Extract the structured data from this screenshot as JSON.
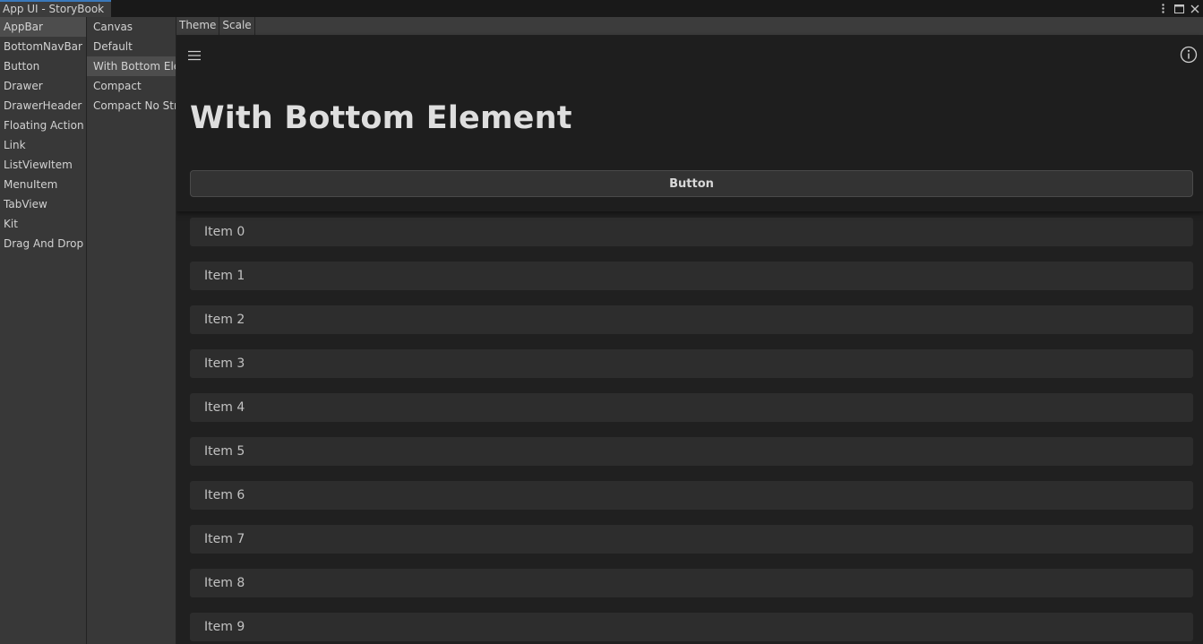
{
  "window": {
    "tab_title": "App UI - StoryBook"
  },
  "stories": [
    {
      "label": "AppBar",
      "selected": true
    },
    {
      "label": "BottomNavBar"
    },
    {
      "label": "Button"
    },
    {
      "label": "Drawer"
    },
    {
      "label": "DrawerHeader"
    },
    {
      "label": "Floating Action Button"
    },
    {
      "label": "Link"
    },
    {
      "label": "ListViewItem"
    },
    {
      "label": "MenuItem"
    },
    {
      "label": "TabView"
    },
    {
      "label": "Kit"
    },
    {
      "label": "Drag And Drop"
    }
  ],
  "variants": [
    {
      "label": "Canvas"
    },
    {
      "label": "Default"
    },
    {
      "label": "With Bottom Element",
      "selected": true
    },
    {
      "label": "Compact"
    },
    {
      "label": "Compact No Stretch"
    }
  ],
  "toolbar": {
    "theme_label": "Theme",
    "scale_label": "Scale"
  },
  "appbar": {
    "title": "With Bottom Element",
    "button_label": "Button"
  },
  "items": [
    "Item 0",
    "Item 1",
    "Item 2",
    "Item 3",
    "Item 4",
    "Item 5",
    "Item 6",
    "Item 7",
    "Item 8",
    "Item 9"
  ],
  "icons": {
    "menu": "hamburger-menu-icon",
    "info": "info-icon",
    "more": "more-vertical-icon",
    "maximize": "maximize-icon",
    "close": "close-icon"
  },
  "colors": {
    "accent": "#3a79bb",
    "background": "#202020",
    "panel": "#383838",
    "selected": "#4d4d4d"
  }
}
